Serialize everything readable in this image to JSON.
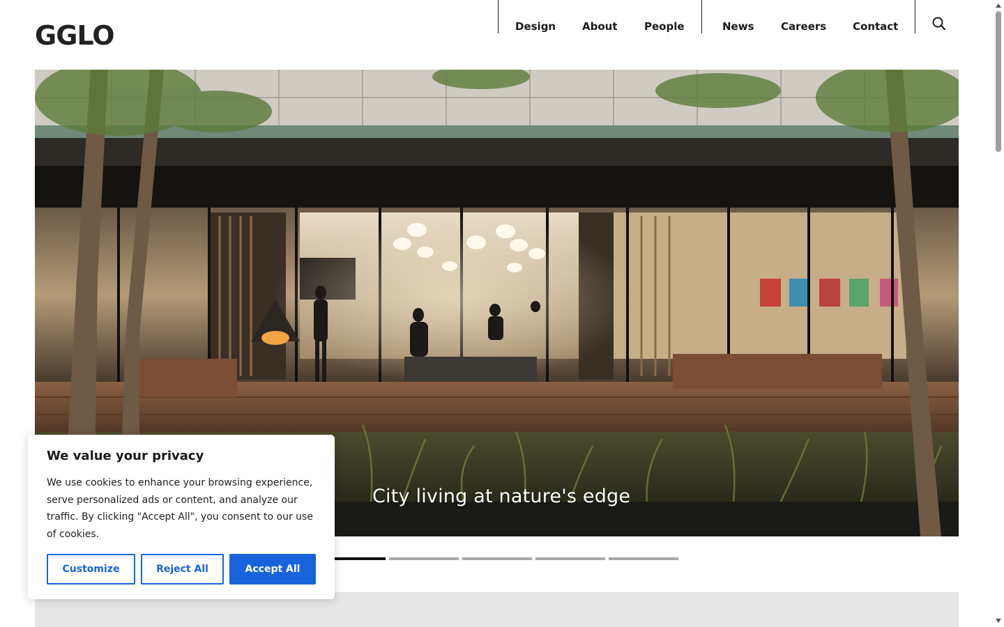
{
  "header": {
    "logo": "GGLO",
    "nav": [
      {
        "label": "Design"
      },
      {
        "label": "About"
      },
      {
        "label": "People"
      },
      {
        "label": "News"
      },
      {
        "label": "Careers"
      },
      {
        "label": "Contact"
      }
    ],
    "search_icon": "search-icon"
  },
  "hero": {
    "caption": "City living at nature's edge",
    "slide_count": 6,
    "active_slide": 0
  },
  "cookie_banner": {
    "title": "We value your privacy",
    "text": "We use cookies to enhance your browsing experience, serve personalized ads or content, and analyze our traffic. By clicking \"Accept All\", you consent to our use of cookies.",
    "customize_label": "Customize",
    "reject_label": "Reject All",
    "accept_label": "Accept All"
  },
  "colors": {
    "accent": "#1863dc",
    "text": "#1a1a1a",
    "band": "#e6e6e6"
  }
}
